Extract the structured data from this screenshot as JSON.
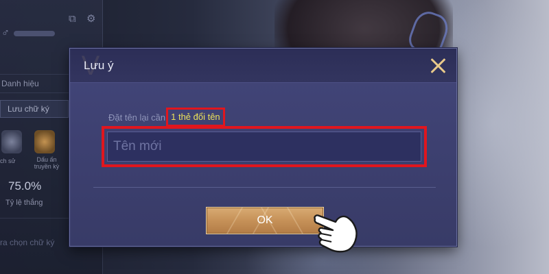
{
  "side_panel": {
    "title_label": "Danh hiệu",
    "save_signature_label": "Lưu chữ ký",
    "stat1_label": "ch sử",
    "stat2_label_line1": "Dấu ấn",
    "stat2_label_line2": "truyền kỳ",
    "win_rate_value": "75.0%",
    "win_rate_label": "Tỷ lệ thắng",
    "choose_signature_label": "ra chọn chữ ký"
  },
  "modal": {
    "title": "Lưu ý",
    "hint_prefix": "Đặt tên lại cần",
    "hint_highlight": "1 thẻ đổi tên",
    "name_input": {
      "placeholder": "Tên mới",
      "value": ""
    },
    "ok_label": "OK"
  },
  "colors": {
    "accent_gold": "#e8c98a",
    "highlight_yellow": "#ece25a",
    "annotation_red": "#e0161e",
    "modal_bg": "#3d4070"
  },
  "icons": {
    "close": "close-icon",
    "hand_pointer": "hand-pointer-icon",
    "gender": "male-icon",
    "settings": "gear-icon"
  }
}
